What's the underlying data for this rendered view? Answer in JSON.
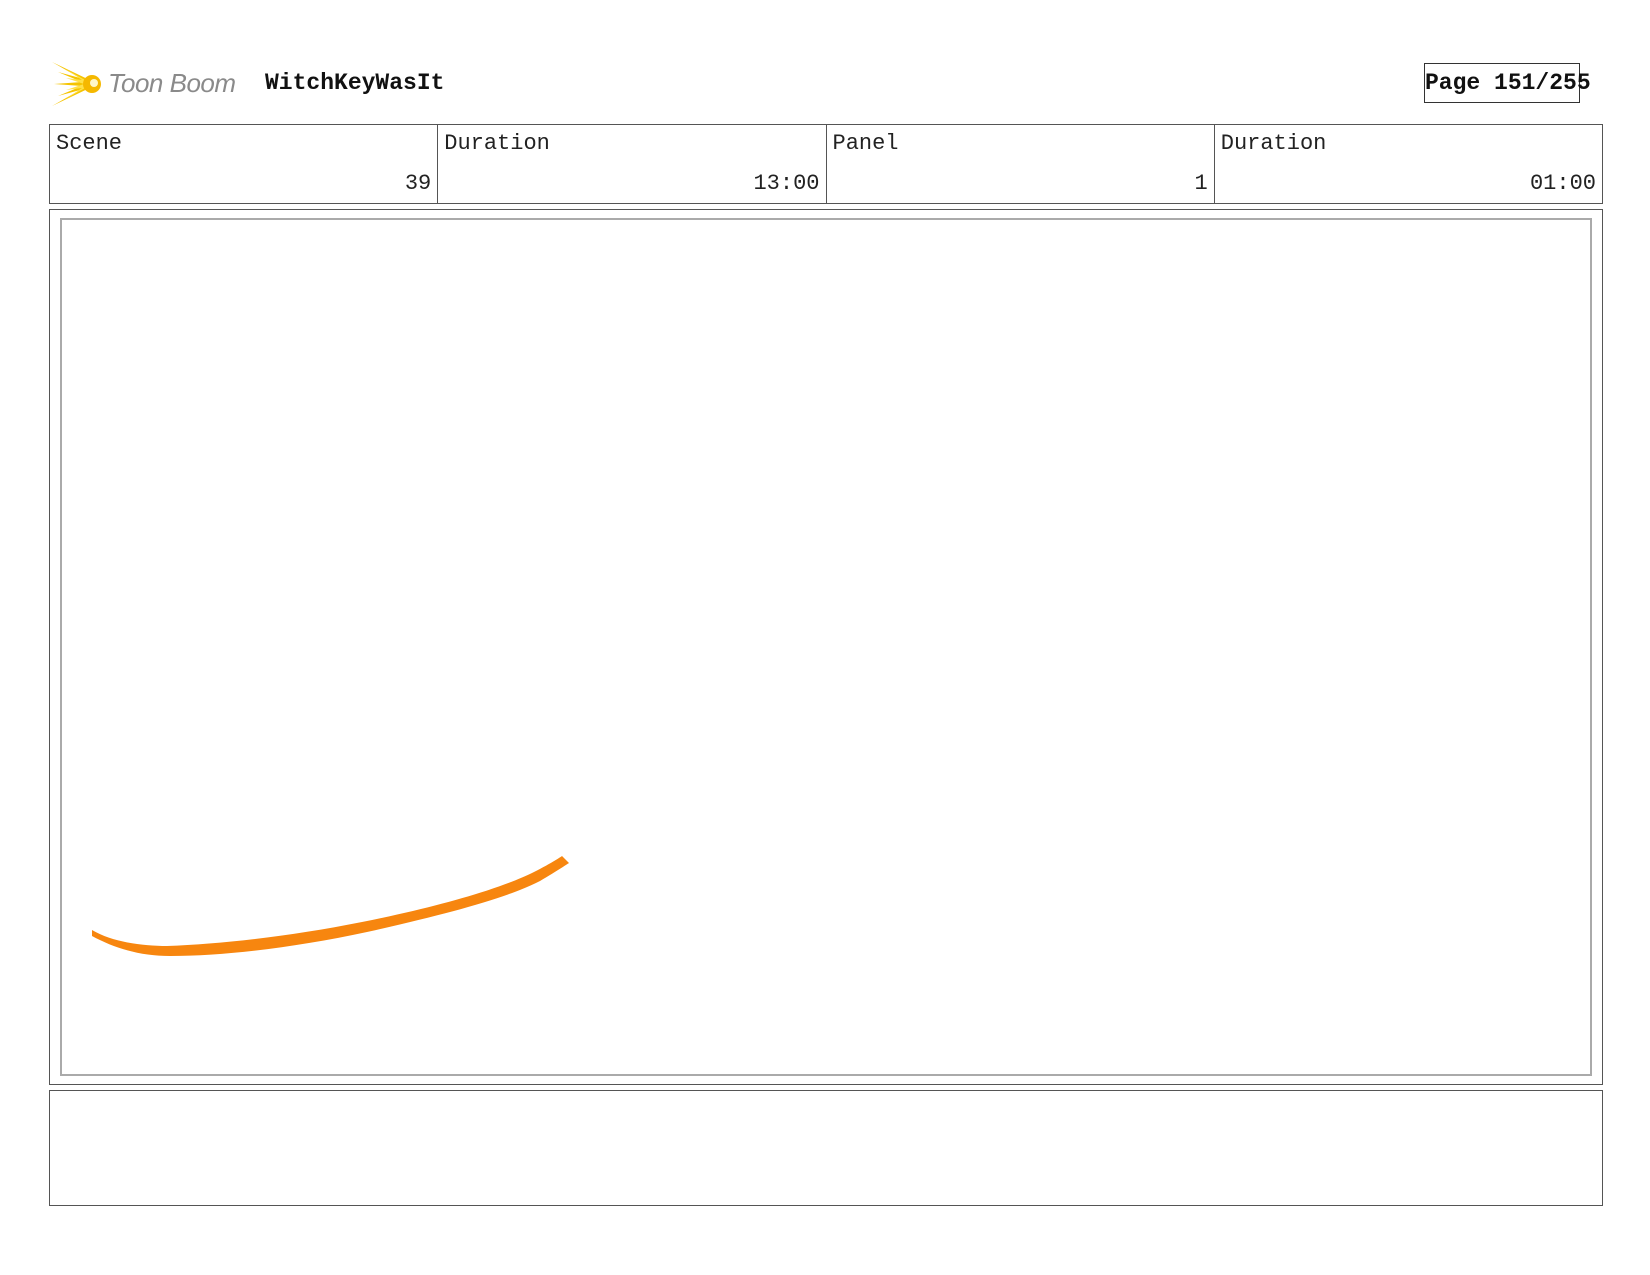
{
  "header": {
    "logo_text": "Toon Boom",
    "project_title": "WitchKeyWasIt",
    "page_label": "Page 151/255"
  },
  "info": {
    "scene_label": "Scene",
    "scene_value": "39",
    "scene_duration_label": "Duration",
    "scene_duration_value": "13:00",
    "panel_label": "Panel",
    "panel_value": "1",
    "panel_duration_label": "Duration",
    "panel_duration_value": "01:00"
  },
  "drawing": {
    "stroke_color": "#f7860f",
    "logo_color": "#f5c400"
  }
}
